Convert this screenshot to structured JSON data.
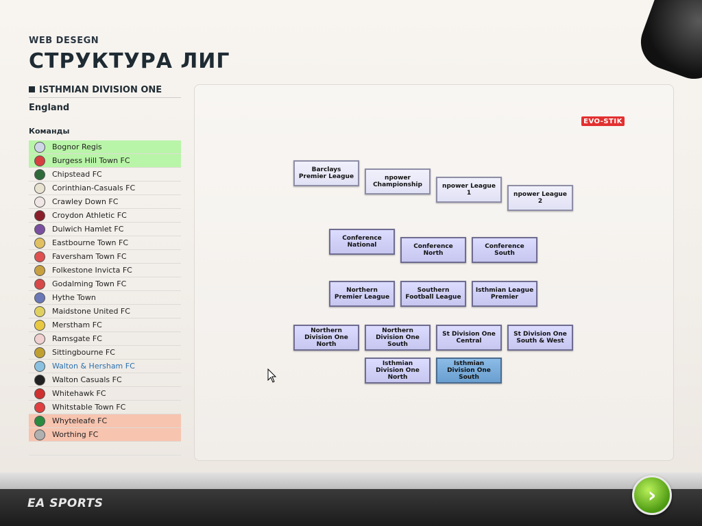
{
  "header": {
    "subtitle": "WEB DESEGN",
    "title": "СТРУКТУРА ЛИГ"
  },
  "division": {
    "name": "ISTHMIAN DIVISION ONE"
  },
  "country": "England",
  "teams_label": "Команды",
  "teams": [
    {
      "name": "Bognor Regis",
      "status": "promotion"
    },
    {
      "name": "Burgess Hill Town FC",
      "status": "promotion"
    },
    {
      "name": "Chipstead FC",
      "status": ""
    },
    {
      "name": "Corinthian-Casuals FC",
      "status": ""
    },
    {
      "name": "Crawley Down FC",
      "status": ""
    },
    {
      "name": "Croydon Athletic FC",
      "status": ""
    },
    {
      "name": "Dulwich Hamlet FC",
      "status": ""
    },
    {
      "name": "Eastbourne Town FC",
      "status": ""
    },
    {
      "name": "Faversham Town FC",
      "status": ""
    },
    {
      "name": "Folkestone Invicta FC",
      "status": ""
    },
    {
      "name": "Godalming Town FC",
      "status": ""
    },
    {
      "name": "Hythe Town",
      "status": ""
    },
    {
      "name": "Maidstone United FC",
      "status": ""
    },
    {
      "name": "Merstham FC",
      "status": ""
    },
    {
      "name": "Ramsgate FC",
      "status": ""
    },
    {
      "name": "Sittingbourne FC",
      "status": ""
    },
    {
      "name": "Walton & Hersham FC",
      "status": "selected"
    },
    {
      "name": "Walton Casuals FC",
      "status": ""
    },
    {
      "name": "Whitehawk FC",
      "status": ""
    },
    {
      "name": "Whitstable Town FC",
      "status": ""
    },
    {
      "name": "Whyteleafe FC",
      "status": "relegation"
    },
    {
      "name": "Worthing FC",
      "status": "relegation"
    }
  ],
  "sponsor": "EVO-STIK",
  "leagues": [
    "Barclays Premier League",
    "npower Championship",
    "npower League 1",
    "npower League 2",
    "Conference National",
    "Conference North",
    "Conference South",
    "Northern Premier League",
    "Southern Football League",
    "Isthmian League Premier",
    "Northern Division One North",
    "Northern Division One South",
    "St Division One Central",
    "St Division One South & West",
    "Isthmian Division One North",
    "Isthmian Division One South"
  ],
  "footer": {
    "logo": "EA SPORTS",
    "next_glyph": "›"
  },
  "colors": {
    "promotion": "#b9f5a8",
    "relegation": "#f7c4b0",
    "selected_text": "#2b6fae",
    "current_league": "#7aaedc"
  }
}
